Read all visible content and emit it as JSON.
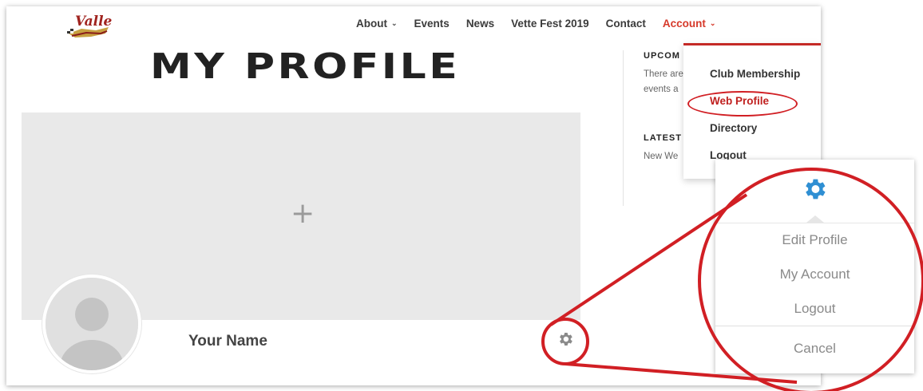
{
  "nav": {
    "items": [
      {
        "label": "About",
        "chevron": "⌄"
      },
      {
        "label": "Events"
      },
      {
        "label": "News"
      },
      {
        "label": "Vette Fest 2019"
      },
      {
        "label": "Contact"
      },
      {
        "label": "Account",
        "chevron": "⌄"
      }
    ]
  },
  "main": {
    "title": "MY PROFILE",
    "cover_plus": "+",
    "name": "Your Name"
  },
  "sidebar": {
    "upcoming_heading": "UPCOM",
    "upcoming_text_1": "There are",
    "upcoming_text_2": "events a",
    "latest_heading": "LATEST",
    "latest_text": "New We"
  },
  "account_menu": {
    "items": [
      "Club Membership",
      "Web Profile",
      "Directory",
      "Logout"
    ]
  },
  "profile_menu": {
    "edit": "Edit Profile",
    "account": "My Account",
    "logout": "Logout",
    "cancel": "Cancel"
  },
  "colors": {
    "accent": "#d6392a",
    "callout": "#d11f24",
    "gear_blue": "#2f8fd3",
    "gear_gray": "#8a8a8a"
  }
}
